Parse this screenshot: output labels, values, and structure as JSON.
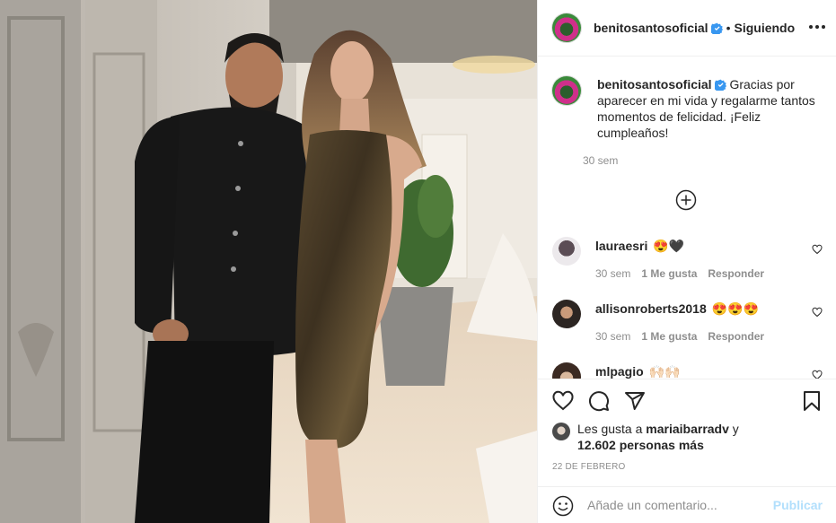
{
  "post": {
    "image_alt": "Photo of a man in black jacket and a woman in a sparkling bronze dress in a bridal store"
  },
  "header": {
    "username": "benitosantosoficial",
    "separator": "•",
    "follow_status": "Siguiendo",
    "verified_icon": "verified-badge-icon",
    "more_icon": "more-options-icon"
  },
  "caption": {
    "username": "benitosantosoficial",
    "text": "Gracias por aparecer en mi vida y regalarme tantos momentos de felicidad. ¡Feliz cumpleaños!",
    "time": "30 sem"
  },
  "comments": [
    {
      "username": "lauraesri",
      "text": "😍🖤",
      "time": "30 sem",
      "likes": "1 Me gusta",
      "reply": "Responder"
    },
    {
      "username": "allisonroberts2018",
      "text": "😍😍😍",
      "time": "30 sem",
      "likes": "1 Me gusta",
      "reply": "Responder"
    },
    {
      "username": "mlpagio",
      "text": "🙌🏻🙌🏻"
    }
  ],
  "actions": {
    "like_icon": "heart-icon",
    "comment_icon": "comment-icon",
    "share_icon": "share-icon",
    "save_icon": "bookmark-icon"
  },
  "likes": {
    "prefix": "Les gusta a ",
    "user": "mariaibarradv",
    "conjunction": " y",
    "count": "12.602 personas más"
  },
  "date": "22 DE FEBRERO",
  "add_comment": {
    "placeholder": "Añade un comentario...",
    "publish_label": "Publicar"
  },
  "colors": {
    "verified": "#3897f0",
    "muted_text": "#8e8e8e",
    "publish_disabled": "#b2dffc",
    "border": "#efefef"
  }
}
